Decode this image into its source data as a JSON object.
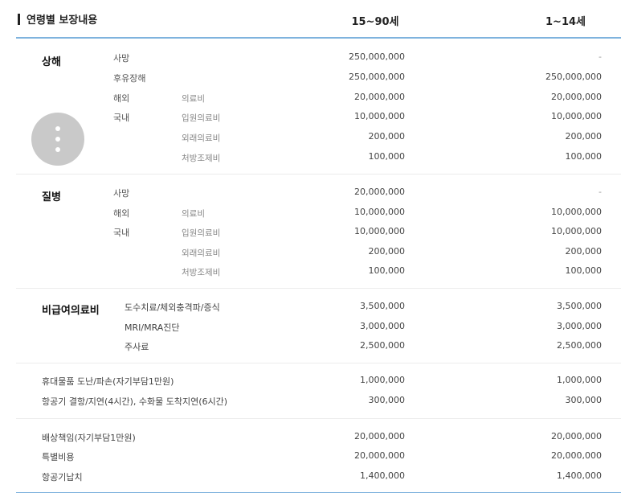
{
  "header": {
    "title": "연령별 보장내용",
    "col_adult": "15~90세",
    "col_child": "1~14세"
  },
  "sections": {
    "injury": {
      "category": "상해",
      "rows": [
        {
          "label": "사망",
          "adult": "250,000,000",
          "child": "-"
        },
        {
          "label": "후유장해",
          "adult": "250,000,000",
          "child": "250,000,000"
        },
        {
          "label": "해외",
          "sub": "의료비",
          "adult": "20,000,000",
          "child": "20,000,000"
        },
        {
          "label": "국내",
          "sub": "입원의료비",
          "adult": "10,000,000",
          "child": "10,000,000"
        },
        {
          "sub": "외래의료비",
          "adult": "200,000",
          "child": "200,000"
        },
        {
          "sub": "처방조제비",
          "adult": "100,000",
          "child": "100,000"
        }
      ]
    },
    "disease": {
      "category": "질병",
      "rows": [
        {
          "label": "사망",
          "adult": "20,000,000",
          "child": "-"
        },
        {
          "label": "해외",
          "sub": "의료비",
          "adult": "10,000,000",
          "child": "10,000,000"
        },
        {
          "label": "국내",
          "sub": "입원의료비",
          "adult": "10,000,000",
          "child": "10,000,000"
        },
        {
          "sub": "외래의료비",
          "adult": "200,000",
          "child": "200,000"
        },
        {
          "sub": "처방조제비",
          "adult": "100,000",
          "child": "100,000"
        }
      ]
    },
    "noncovered": {
      "category": "비급여의료비",
      "rows": [
        {
          "label": "도수치료/체외충격파/증식",
          "adult": "3,500,000",
          "child": "3,500,000"
        },
        {
          "label": "MRI/MRA진단",
          "adult": "3,000,000",
          "child": "3,000,000"
        },
        {
          "label": "주사료",
          "adult": "2,500,000",
          "child": "2,500,000"
        }
      ]
    },
    "travel": {
      "rows": [
        {
          "label": "휴대물품 도난/파손(자기부담1만원)",
          "adult": "1,000,000",
          "child": "1,000,000"
        },
        {
          "label": "항공기 결항/지연(4시간), 수화물 도착지연(6시간)",
          "adult": "300,000",
          "child": "300,000"
        }
      ]
    },
    "liability": {
      "rows": [
        {
          "label": "배상책임(자기부담1만원)",
          "adult": "20,000,000",
          "child": "20,000,000"
        },
        {
          "label": "특별비용",
          "adult": "20,000,000",
          "child": "20,000,000"
        },
        {
          "label": "항공기납치",
          "adult": "1,400,000",
          "child": "1,400,000"
        }
      ]
    }
  },
  "overlay": {
    "icon": "more-vertical-icon"
  },
  "colors": {
    "accent_line": "#7fb3de",
    "fab": "#c9c9c9"
  }
}
